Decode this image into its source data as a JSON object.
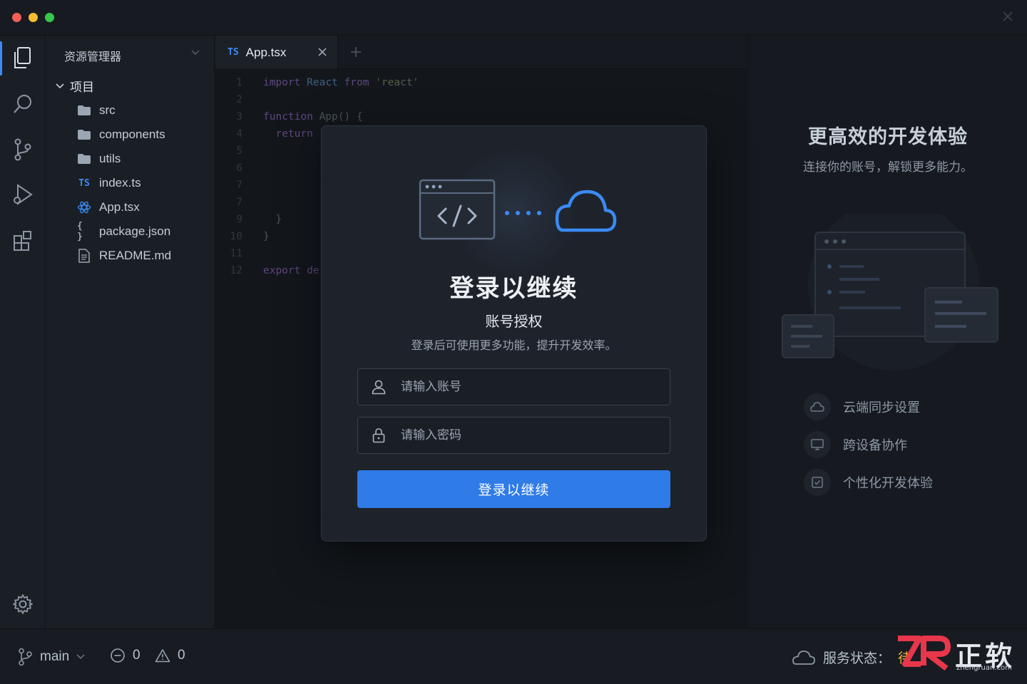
{
  "window": {
    "close_icon": "close-icon"
  },
  "activity_bar": {
    "items": [
      "files-icon",
      "search-icon",
      "source-control-icon",
      "run-debug-icon",
      "extensions-icon"
    ],
    "settings_icon": "gear-icon"
  },
  "explorer": {
    "title": "资源管理器",
    "root_label": "项目",
    "items": [
      {
        "label": "src",
        "icon": "folder-icon"
      },
      {
        "label": "components",
        "icon": "folder-icon"
      },
      {
        "label": "utils",
        "icon": "folder-icon"
      },
      {
        "label": "index.ts",
        "icon": "typescript-file-icon",
        "badge": "TS"
      },
      {
        "label": "App.tsx",
        "icon": "react-file-icon"
      },
      {
        "label": "package.json",
        "icon": "json-file-icon",
        "badge": "{ }"
      },
      {
        "label": "README.md",
        "icon": "markdown-file-icon"
      }
    ]
  },
  "editor": {
    "tab": {
      "badge": "TS",
      "label": "App.tsx"
    },
    "lines": [
      {
        "n": "1",
        "text": "import React from 'react'"
      },
      {
        "n": "2",
        "text": ""
      },
      {
        "n": "3",
        "text": "function App() {"
      },
      {
        "n": "4",
        "text": "  return"
      },
      {
        "n": "5",
        "text": ""
      },
      {
        "n": "6",
        "text": ""
      },
      {
        "n": "7",
        "text": ""
      },
      {
        "n": "7",
        "text": ""
      },
      {
        "n": "9",
        "text": "  }"
      },
      {
        "n": "10",
        "text": "}"
      },
      {
        "n": "11",
        "text": ""
      },
      {
        "n": "12",
        "text": "export de"
      }
    ]
  },
  "right_panel": {
    "title": "更高效的开发体验",
    "subtitle": "连接你的账号，解锁更多能力。",
    "features": [
      {
        "label": "云端同步设置",
        "icon": "cloud-icon"
      },
      {
        "label": "跨设备协作",
        "icon": "monitor-icon"
      },
      {
        "label": "个性化开发体验",
        "icon": "checkbox-icon"
      }
    ]
  },
  "modal": {
    "title": "登录以继续",
    "subtitle": "账号授权",
    "description": "登录后可使用更多功能，提升开发效率。",
    "account_placeholder": "请输入账号",
    "password_placeholder": "请输入密码",
    "submit_label": "登录以继续"
  },
  "status_bar": {
    "branch": "main",
    "errors": "0",
    "warnings": "0",
    "service_label": "服务状态：",
    "service_value": "待",
    "accent_color": "#e6b93c"
  },
  "watermark": {
    "brand": "正软",
    "url": "zhengruan.com"
  },
  "colors": {
    "accent": "#2f7be8",
    "background": "#15191f",
    "panel": "#1a1f26"
  }
}
